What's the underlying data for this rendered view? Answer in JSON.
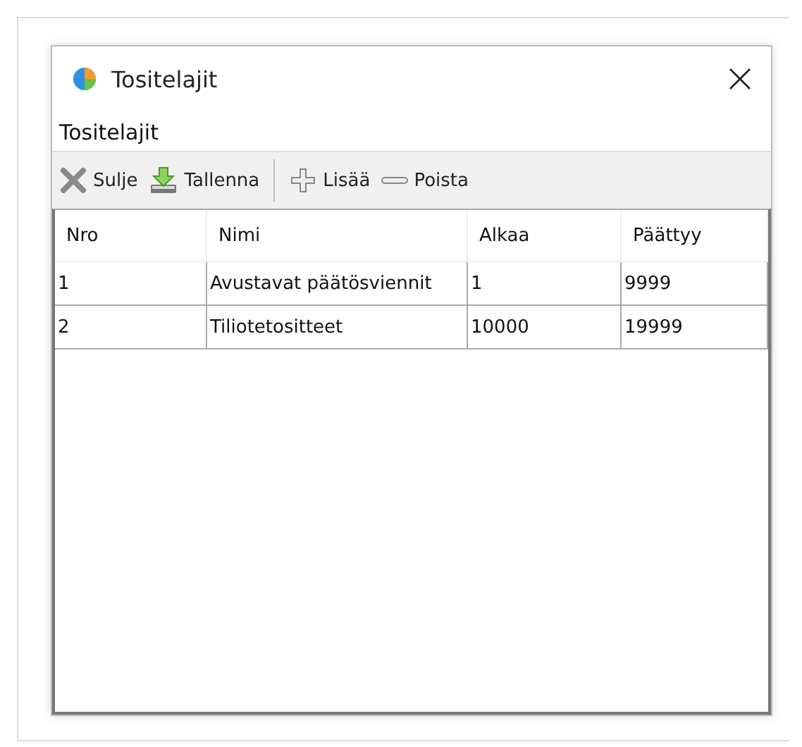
{
  "window": {
    "title": "Tositelajit"
  },
  "heading": "Tositelajit",
  "toolbar": [
    {
      "label": "Sulje",
      "kind": "close"
    },
    {
      "label": "Tallenna",
      "kind": "save"
    },
    {
      "label": "Lisää",
      "kind": "add"
    },
    {
      "label": "Poista",
      "kind": "remove"
    }
  ],
  "table": {
    "columns": [
      "Nro",
      "Nimi",
      "Alkaa",
      "Päättyy"
    ],
    "rows": [
      [
        "1",
        "Avustavat päätösviennit",
        "1",
        "9999"
      ],
      [
        "2",
        "Tiliotetositteet",
        "10000",
        "19999"
      ]
    ]
  }
}
